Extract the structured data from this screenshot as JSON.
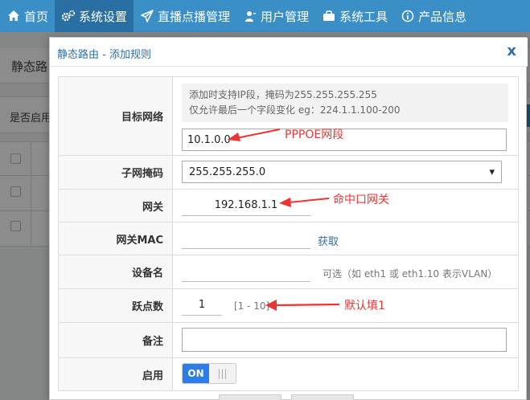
{
  "nav": {
    "items": [
      {
        "label": "首页",
        "icon": "home-icon"
      },
      {
        "label": "系统设置",
        "icon": "gears-icon"
      },
      {
        "label": "直播点播管理",
        "icon": "paper-plane-icon"
      },
      {
        "label": "用户管理",
        "icon": "user-icon"
      },
      {
        "label": "系统工具",
        "icon": "briefcase-icon"
      },
      {
        "label": "产品信息",
        "icon": "info-icon"
      }
    ],
    "active_index": 1
  },
  "background": {
    "title": "静态路",
    "enable_label": "是否启用"
  },
  "modal": {
    "title": "静态路由 - 添加规则",
    "close": "x",
    "fields": {
      "target_network": {
        "label": "目标网络",
        "hint_line1": "添加时支持IP段，掩码为255.255.255.255",
        "hint_line2": "仅允许最后一个字段变化 eg：224.1.1.100-200",
        "value": "10.1.0.0"
      },
      "subnet_mask": {
        "label": "子网掩码",
        "value": "255.255.255.0",
        "caret": "▾"
      },
      "gateway": {
        "label": "网关",
        "value": "192.168.1.1"
      },
      "gateway_mac": {
        "label": "网关MAC",
        "value": "",
        "fetch_label": "获取"
      },
      "device_name": {
        "label": "设备名",
        "value": "",
        "hint": "可选（如 eth1 或 eth1.10 表示VLAN）"
      },
      "hop_count": {
        "label": "跃点数",
        "value": "1",
        "range": "[1 - 10]"
      },
      "remark": {
        "label": "备注",
        "value": ""
      },
      "enable": {
        "label": "启用",
        "on_label": "ON",
        "off_label": "|||"
      }
    }
  },
  "annotations": {
    "pppoe": "PPPOE网段",
    "gateway": "命中口网关",
    "default": "默认填1"
  },
  "colors": {
    "nav_bg": "#3a8fc6",
    "accent": "#2f6fa6",
    "annotation": "#e33333",
    "toggle_on": "#2b7de9"
  }
}
